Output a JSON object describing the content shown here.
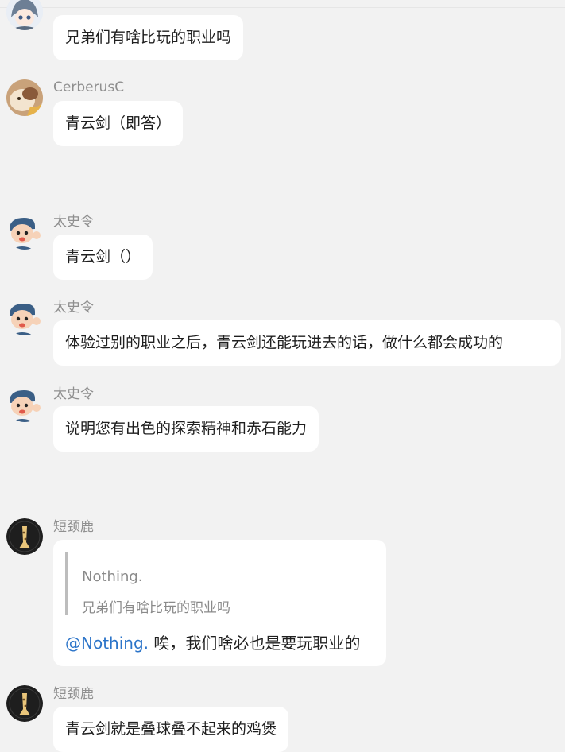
{
  "messages": [
    {
      "sender": "",
      "text": "兄弟们有啥比玩的职业吗",
      "avatar": "anime-girl-avatar"
    },
    {
      "sender": "CerberusC",
      "text": "青云剑（即答）",
      "avatar": "cat-avatar"
    },
    {
      "sender": "太史令",
      "text": "青云剑（）",
      "avatar": "waving-boy-avatar"
    },
    {
      "sender": "太史令",
      "text": "体验过别的职业之后，青云剑还能玩进去的话，做什么都会成功的",
      "avatar": "waving-boy-avatar"
    },
    {
      "sender": "太史令",
      "text": "说明您有出色的探索精神和赤石能力",
      "avatar": "waving-boy-avatar"
    },
    {
      "sender": "短颈鹿",
      "quote": {
        "name": "Nothing.",
        "text": "兄弟们有啥比玩的职业吗"
      },
      "mention": "@Nothing.",
      "text": " 唉，我们啥必也是要玩职业的",
      "avatar": "giraffe-avatar"
    },
    {
      "sender": "短颈鹿",
      "text": "青云剑就是叠球叠不起来的鸡煲",
      "avatar": "giraffe-avatar"
    }
  ]
}
